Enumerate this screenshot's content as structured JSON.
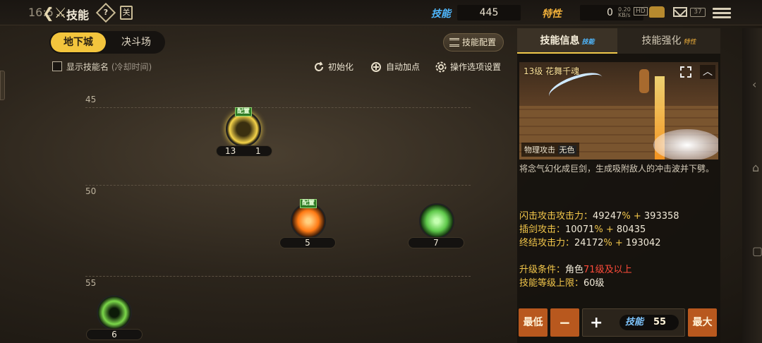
{
  "statusbar": {
    "clock": "16:5",
    "net_speed": "0.20",
    "net_unit": "KB/s",
    "signal_label": "0",
    "battery": "37"
  },
  "header": {
    "title": "技能",
    "help_glyph": "?",
    "book_glyph": "关",
    "skill_points_label": "技能",
    "skill_points_value": "445",
    "trait_label": "特性",
    "trait_value": "0",
    "colors": {
      "skill_label": "#4fb8ff",
      "trait_label": "#f2b13a"
    }
  },
  "tabs": {
    "dungeon": "地下城",
    "arena": "决斗场",
    "active": "dungeon"
  },
  "toolbar": {
    "skill_config": "技能配置",
    "show_names_checkbox": "显示技能名",
    "show_names_sub": "(冷却时间)",
    "show_names_checked": false,
    "reset": "初始化",
    "auto_add": "自动加点",
    "options": "操作选项设置"
  },
  "tree": {
    "levels": [
      "45",
      "50",
      "55"
    ],
    "skills": [
      {
        "id": "skill-a",
        "level": "13",
        "extra": "1",
        "badge": "配置",
        "color": "#f6d44a"
      },
      {
        "id": "skill-b",
        "level": "5",
        "badge": "配置",
        "color": "#ff8a1a"
      },
      {
        "id": "skill-c",
        "level": "7",
        "color": "#6fe05a"
      },
      {
        "id": "skill-d",
        "level": "6",
        "color": "#7bd84a"
      }
    ]
  },
  "panel": {
    "tab_info": "技能信息",
    "tab_info_tag": "技能",
    "tab_enhance": "技能强化",
    "tab_enhance_tag": "特性",
    "preview_title": "13级 花舞千魂",
    "tag_type": "物理攻击",
    "tag_element": "无色",
    "description": "将念气幻化成巨剑，生成吸附敌人的冲击波并下劈。",
    "stats": [
      {
        "label": "闪击攻击攻击力：",
        "pct": "49247",
        "flat": "393358"
      },
      {
        "label": "插剑攻击：",
        "pct": "10071",
        "flat": "80435"
      },
      {
        "label": "终结攻击力：",
        "pct": "24172",
        "flat": "193042"
      }
    ],
    "upgrade_cond_label": "升级条件：",
    "upgrade_cond_prefix": "角色",
    "upgrade_cond_value": "71级及以上",
    "max_level_label": "技能等级上限：",
    "max_level_value": "60级",
    "btn_min": "最低",
    "btn_minus": "−",
    "btn_plus": "+",
    "sp_label": "技能",
    "sp_value": "55",
    "btn_max": "最大"
  }
}
